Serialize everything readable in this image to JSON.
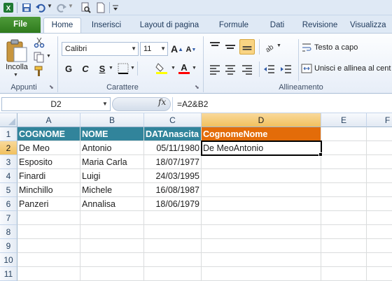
{
  "quick_access": {
    "icons": [
      "excel-logo-icon",
      "save-icon",
      "undo-icon",
      "redo-icon",
      "print-preview-icon",
      "new-file-icon",
      "customize-icon"
    ]
  },
  "tabs": [
    {
      "label": "File"
    },
    {
      "label": "Home"
    },
    {
      "label": "Inserisci"
    },
    {
      "label": "Layout di pagina"
    },
    {
      "label": "Formule"
    },
    {
      "label": "Dati"
    },
    {
      "label": "Revisione"
    },
    {
      "label": "Visualizza"
    }
  ],
  "ribbon": {
    "clipboard": {
      "paste_label": "Incolla",
      "group_label": "Appunti"
    },
    "font": {
      "font_name": "Calibri",
      "font_size": "11",
      "bold": "G",
      "italic": "C",
      "underline": "S",
      "group_label": "Carattere"
    },
    "alignment": {
      "wrap_text": "Testo a capo",
      "merge_center": "Unisci e allinea al cent",
      "group_label": "Allineamento"
    }
  },
  "formula_bar": {
    "name_box": "D2",
    "fx": "fx",
    "formula": "=A2&B2"
  },
  "columns": [
    "A",
    "B",
    "C",
    "D",
    "E",
    "F"
  ],
  "rows": [
    "1",
    "2",
    "3",
    "4",
    "5",
    "6",
    "7",
    "8",
    "9",
    "10",
    "11"
  ],
  "headers": [
    "COGNOME",
    "NOME",
    "DATAnascita",
    "CognomeNome"
  ],
  "data_rows": [
    [
      "De Meo",
      "Antonio",
      "05/11/1980",
      "De MeoAntonio"
    ],
    [
      "Esposito",
      "Maria Carla",
      "18/07/1977",
      ""
    ],
    [
      "Finardi",
      "Luigi",
      "24/03/1995",
      ""
    ],
    [
      "Minchillo",
      "Michele",
      "16/08/1987",
      ""
    ],
    [
      "Panzeri",
      "Annalisa",
      "18/06/1979",
      ""
    ]
  ],
  "colors": {
    "header_teal": "#31849b",
    "header_orange": "#e36c09",
    "file_tab": "#3a8a28",
    "selected_header": "#f5cd78"
  }
}
